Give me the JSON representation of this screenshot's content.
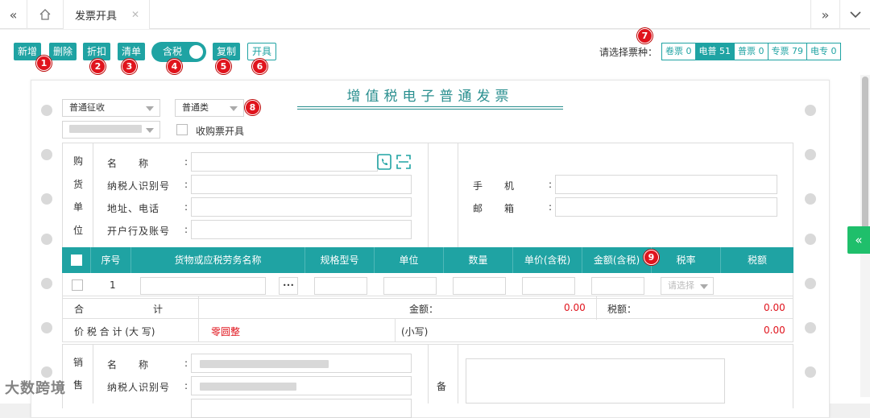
{
  "tabs": {
    "active_label": "发票开具"
  },
  "toolbar": {
    "add": "新增",
    "delete": "删除",
    "discount": "折扣",
    "list": "清单",
    "tax_toggle": "含税",
    "copy": "复制",
    "issue": "开具"
  },
  "badges": {
    "b1": "1",
    "b2": "2",
    "b3": "3",
    "b4": "4",
    "b5": "5",
    "b6": "6",
    "b7": "7",
    "b8": "8",
    "b9": "9"
  },
  "ticket": {
    "label": "请选择票种：",
    "types": [
      {
        "label": "卷票 0"
      },
      {
        "label": "电普 51"
      },
      {
        "label": "普票 0"
      },
      {
        "label": "专票 79"
      },
      {
        "label": "电专 0"
      }
    ]
  },
  "invoice": {
    "title": "增值税电子普通发票",
    "levy_select": "普通征收",
    "category_select": "普通类",
    "purchase_ticket_label": "收购票开具",
    "buyer": {
      "side_label": [
        "购",
        "货",
        "单",
        "位"
      ],
      "name_label": "名　　称",
      "taxid_label": "纳税人识别号",
      "address_label": "地址、电话",
      "bank_label": "开户行及账号",
      "phone_label": "手　　机",
      "email_label": "邮　　箱",
      "colon": ":"
    },
    "table": {
      "headers": [
        "序号",
        "货物或应税劳务名称",
        "规格型号",
        "单位",
        "数量",
        "单价(含税)",
        "金额(含税)",
        "税率",
        "税额"
      ],
      "row_index": "1",
      "more_button": "•••",
      "tax_rate_placeholder": "请选择"
    },
    "totals": {
      "total_label": "合　　　　　　计",
      "amount_label": "金额：",
      "amount_value": "0.00",
      "tax_label": "税额：",
      "tax_value": "0.00",
      "grand_label": "价 税 合 计 (大 写)",
      "grand_upper": "零圆整",
      "small_label": "(小写)",
      "small_value": "0.00"
    },
    "seller": {
      "side_label": [
        "销",
        "售"
      ],
      "name_label": "名　　称",
      "taxid_label": "纳税人识别号",
      "remark_label": "备"
    }
  },
  "side_toggle": "«",
  "watermark": "大数跨境"
}
